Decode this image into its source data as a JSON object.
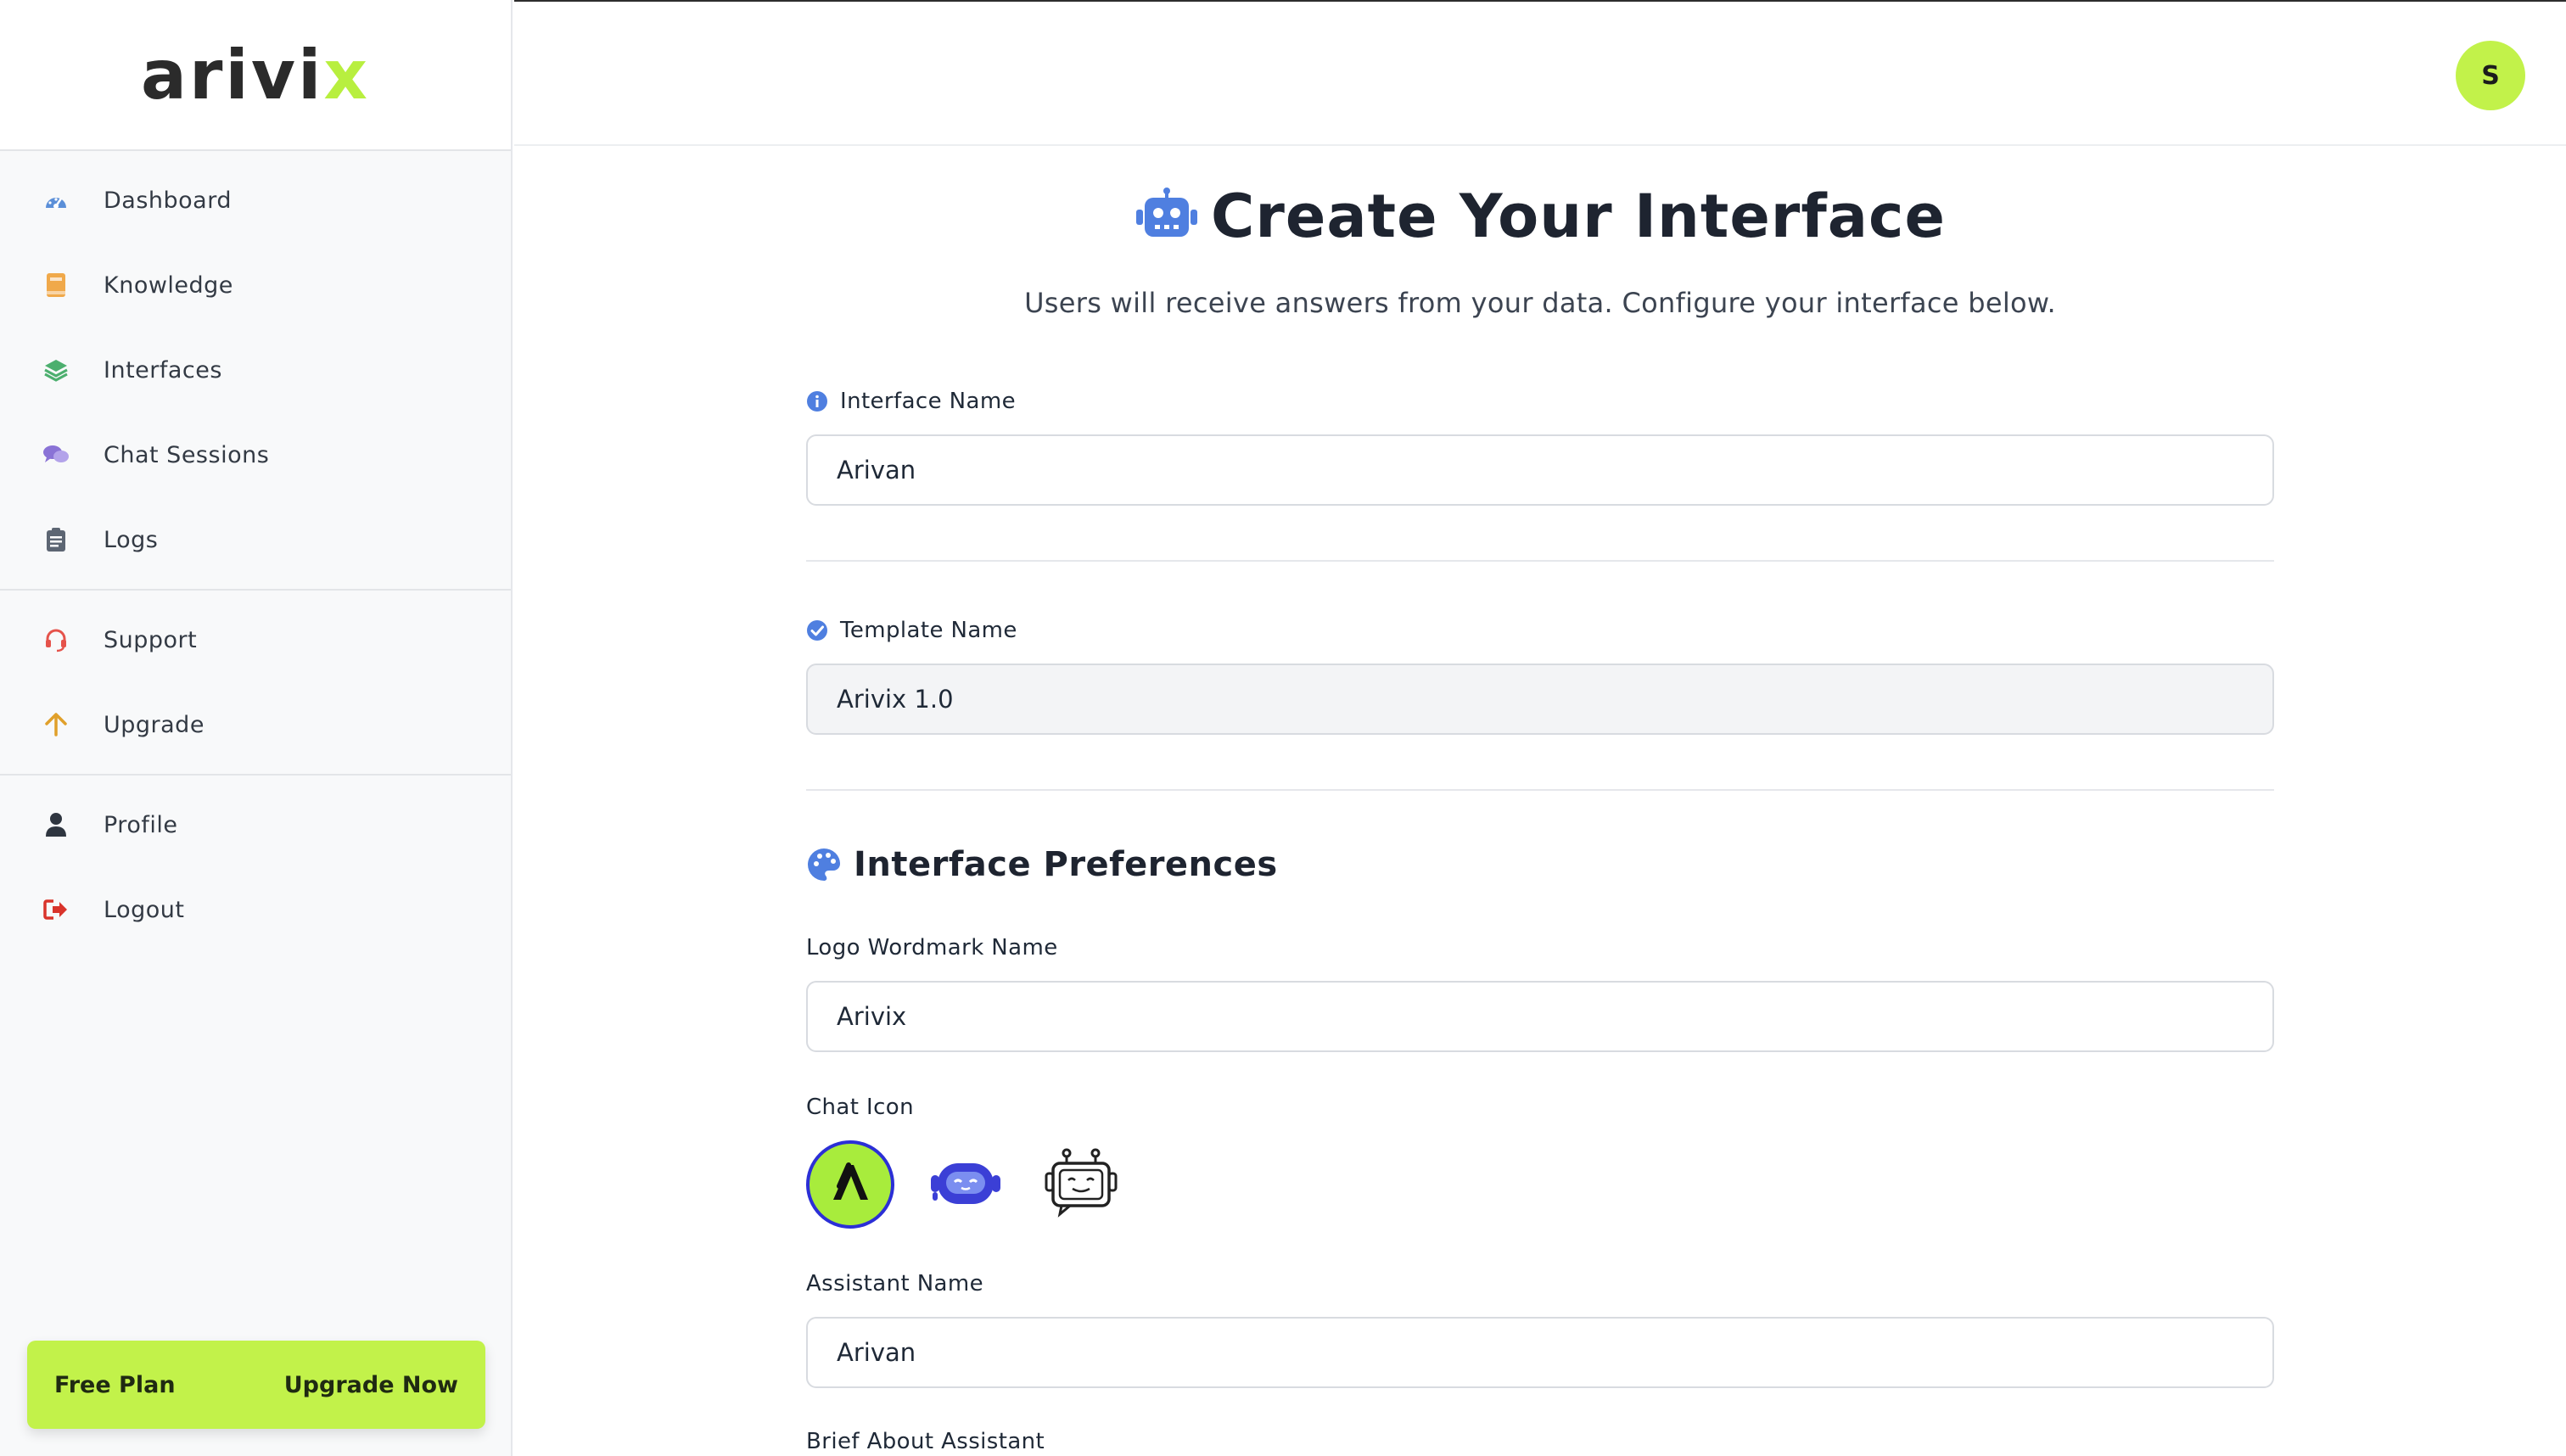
{
  "brand": {
    "word": "arivi",
    "accent_letter": "x",
    "accent_color": "#b8ef3f"
  },
  "sidebar": {
    "primary": [
      {
        "label": "Dashboard",
        "icon": "dashboard-gauge-icon"
      },
      {
        "label": "Knowledge",
        "icon": "book-icon"
      },
      {
        "label": "Interfaces",
        "icon": "layers-icon"
      },
      {
        "label": "Chat Sessions",
        "icon": "chat-bubbles-icon"
      },
      {
        "label": "Logs",
        "icon": "clipboard-icon"
      }
    ],
    "secondary": [
      {
        "label": "Support",
        "icon": "headset-icon"
      },
      {
        "label": "Upgrade",
        "icon": "arrow-up-icon"
      }
    ],
    "account": [
      {
        "label": "Profile",
        "icon": "user-icon"
      },
      {
        "label": "Logout",
        "icon": "logout-icon"
      }
    ],
    "plan": {
      "name": "Free Plan",
      "cta": "Upgrade Now",
      "color": "#c2f24a"
    }
  },
  "header": {
    "avatar_initial": "S"
  },
  "page": {
    "title": "Create Your Interface",
    "subtitle": "Users will receive answers from your data. Configure your interface below.",
    "interface_name": {
      "label": "Interface Name",
      "value": "Arivan"
    },
    "template_name": {
      "label": "Template Name",
      "value": "Arivix 1.0"
    },
    "preferences": {
      "title": "Interface Preferences",
      "logo_wordmark": {
        "label": "Logo Wordmark Name",
        "value": "Arivix"
      },
      "chat_icon": {
        "label": "Chat Icon",
        "options": [
          {
            "name": "letter-a-icon",
            "glyph": "A",
            "selected": true
          },
          {
            "name": "robot-face-icon",
            "selected": false
          },
          {
            "name": "robot-chat-icon",
            "selected": false
          }
        ]
      },
      "assistant_name": {
        "label": "Assistant Name",
        "value": "Arivan"
      },
      "brief": {
        "label": "Brief About Assistant"
      }
    }
  }
}
